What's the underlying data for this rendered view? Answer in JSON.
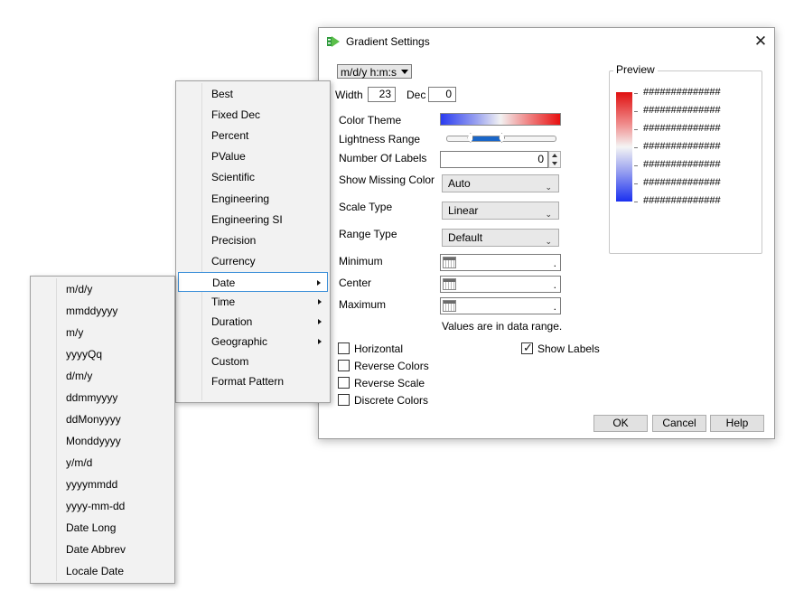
{
  "dialog": {
    "title": "Gradient Settings",
    "format_value": "m/d/y h:m:s",
    "width_label": "Width",
    "width_value": "23",
    "dec_label": "Dec",
    "dec_value": "0",
    "color_theme_label": "Color Theme",
    "lightness_label": "Lightness Range",
    "lightness_range": [
      0.22,
      0.5
    ],
    "num_labels_label": "Number Of Labels",
    "num_labels_value": "0",
    "show_missing_label": "Show Missing Color",
    "show_missing_value": "Auto",
    "scale_type_label": "Scale Type",
    "scale_type_value": "Linear",
    "range_type_label": "Range Type",
    "range_type_value": "Default",
    "minimum_label": "Minimum",
    "minimum_value": ".",
    "center_label": "Center",
    "center_value": ".",
    "maximum_label": "Maximum",
    "maximum_value": ".",
    "range_note": "Values are in data range.",
    "checkboxes": [
      {
        "label": "Horizontal",
        "checked": false
      },
      {
        "label": "Reverse Colors",
        "checked": false
      },
      {
        "label": "Reverse Scale",
        "checked": false
      },
      {
        "label": "Discrete Colors",
        "checked": false
      }
    ],
    "show_labels": {
      "label": "Show Labels",
      "checked": true
    },
    "preview": {
      "title": "Preview",
      "labels": [
        "##############",
        "##############",
        "##############",
        "##############",
        "##############",
        "##############",
        "##############"
      ]
    },
    "buttons": {
      "ok": "OK",
      "cancel": "Cancel",
      "help": "Help"
    },
    "colors": {
      "gradient_low": "#1a30f0",
      "gradient_mid": "#f2f2f2",
      "gradient_high": "#e81010",
      "slider_fill": "#1a66c8"
    }
  },
  "format_menu": {
    "items": [
      {
        "label": "Best",
        "submenu": false
      },
      {
        "label": "Fixed Dec",
        "submenu": false
      },
      {
        "label": "Percent",
        "submenu": false
      },
      {
        "label": "PValue",
        "submenu": false
      },
      {
        "label": "Scientific",
        "submenu": false
      },
      {
        "label": "Engineering",
        "submenu": false
      },
      {
        "label": "Engineering SI",
        "submenu": false
      },
      {
        "label": "Precision",
        "submenu": false
      },
      {
        "label": "Currency",
        "submenu": false
      },
      {
        "label": "Date",
        "submenu": true,
        "highlighted": true
      },
      {
        "label": "Time",
        "submenu": true
      },
      {
        "label": "Duration",
        "submenu": true
      },
      {
        "label": "Geographic",
        "submenu": true
      },
      {
        "label": "Custom",
        "submenu": false
      },
      {
        "label": "Format Pattern",
        "submenu": false
      }
    ]
  },
  "date_menu": {
    "items": [
      "m/d/y",
      "mmddyyyy",
      "m/y",
      "yyyyQq",
      "d/m/y",
      "ddmmyyyy",
      "ddMonyyyy",
      "Monddyyyy",
      "y/m/d",
      "yyyymmdd",
      "yyyy-mm-dd",
      "Date Long",
      "Date Abbrev",
      "Locale Date"
    ]
  }
}
